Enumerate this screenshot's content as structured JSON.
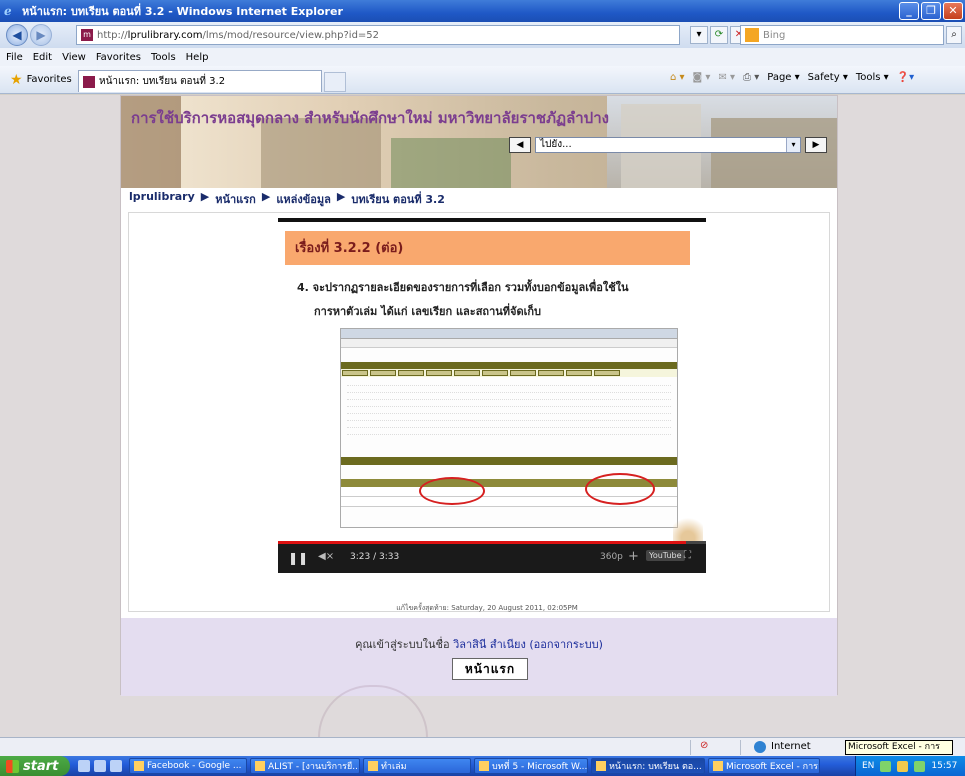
{
  "window": {
    "title": "หน้าแรก: บทเรียน ตอนที่ 3.2 - Windows Internet Explorer",
    "buttons": [
      "_",
      "❐",
      "✕"
    ]
  },
  "address": {
    "url_prefix": "http://",
    "url_host": "lprulibrary.com",
    "url_path": "/lms/mod/resource/view.php?id=52",
    "search_placeholder": "Bing"
  },
  "menu": [
    "File",
    "Edit",
    "View",
    "Favorites",
    "Tools",
    "Help"
  ],
  "favorites_bar": {
    "favorites_label": "Favorites",
    "tab_title": "หน้าแรก: บทเรียน ตอนที่ 3.2",
    "commands": [
      "Page ▾",
      "Safety ▾",
      "Tools ▾"
    ]
  },
  "site": {
    "banner_title": "การใช้บริการหอสมุดกลาง สำหรับนักศึกษาใหม่ มหาวิทยาลัยราชภัฏลำปาง",
    "jump_select": "ไปยัง...",
    "breadcrumb": [
      "lprulibrary",
      "หน้าแรก",
      "แหล่งข้อมูล",
      "บทเรียน ตอนที่ 3.2"
    ],
    "separator": "▶"
  },
  "video": {
    "slide_title": "เรื่องที่ 3.2.2 (ต่อ)",
    "line1": "4.  จะปรากฏรายละเอียดของรายการที่เลือก รวมทั้งบอกข้อมูลเพื่อใช้ใน",
    "line2": "การหาตัวเล่ม ได้แก่ เลขเรียก และสถานที่จัดเก็บ",
    "time": "3:23 / 3:33",
    "quality": "360p",
    "youtube": "YouTube",
    "progress": 0.953
  },
  "modified": "แก้ไขครั้งสุดท้าย: Saturday, 20 August 2011, 02:05PM",
  "footer": {
    "login_prefix": "คุณเข้าสู่ระบบในชื่อ",
    "user_name": "วิลาสินี สำเนียง",
    "logout": "(ออกจากระบบ)",
    "home_button": "หน้าแรก"
  },
  "status": {
    "zone": "Internet",
    "tooltip": "Microsoft Excel - การตลาด"
  },
  "taskbar": {
    "start": "start",
    "buttons": [
      "Facebook - Google ...",
      "ALIST - [งานบริการยื...",
      "ทำเล่ม",
      "บทที่ 5 - Microsoft W...",
      "หน้าแรก: บทเรียน ตอ...",
      "Microsoft Excel - การ..."
    ],
    "lang": "EN",
    "clock": "15:57"
  }
}
